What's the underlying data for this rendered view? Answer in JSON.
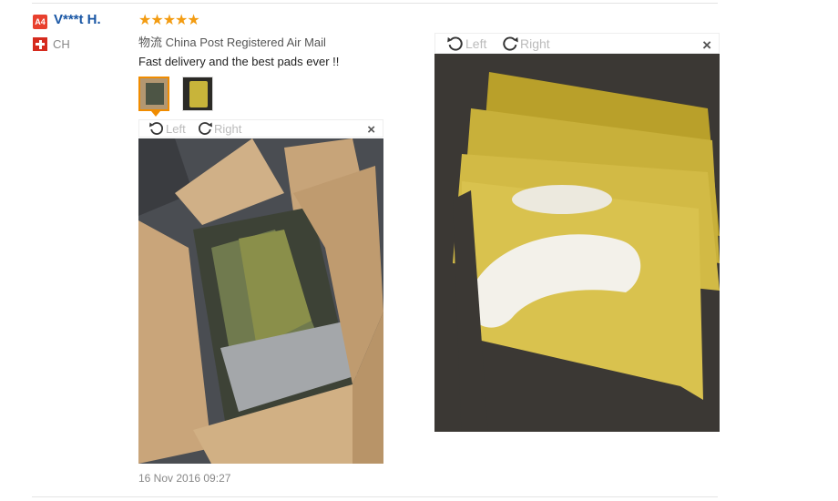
{
  "user": {
    "level_badge": "A4",
    "name": "V***t H.",
    "country": "CH"
  },
  "review": {
    "stars": "★★★★★",
    "shipping": "物流 China Post Registered Air Mail",
    "text": "Fast delivery and the best pads ever !!",
    "date": "16 Nov 2016 09:27"
  },
  "viewer1": {
    "rotate_left": "Left",
    "rotate_right": "Right",
    "close": "×"
  },
  "viewer2": {
    "rotate_left": "Left",
    "rotate_right": "Right",
    "close": "×"
  },
  "colors": {
    "accent": "#f08c00",
    "stars": "#f39c12",
    "username": "#1a57a5",
    "badge": "#e8402e"
  }
}
